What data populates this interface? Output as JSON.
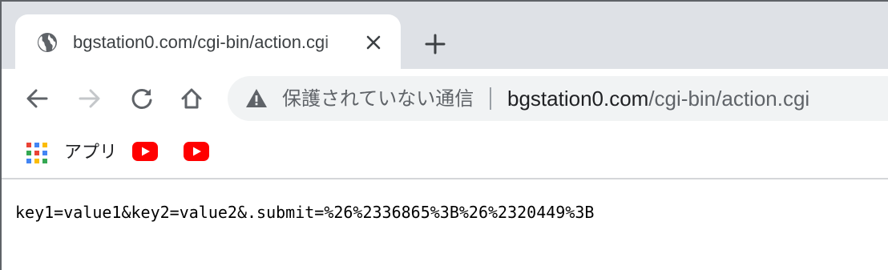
{
  "tab": {
    "title": "bgstation0.com/cgi-bin/action.cgi",
    "favicon_icon": "globe-icon",
    "close_icon": "close-icon"
  },
  "toolbar": {
    "back_icon": "back-arrow-icon",
    "forward_icon": "forward-arrow-icon",
    "reload_icon": "reload-icon",
    "home_icon": "home-icon",
    "new_tab_icon": "plus-icon"
  },
  "omnibox": {
    "security_icon": "warning-triangle-icon",
    "security_text": "保護されていない通信",
    "url_host": "bgstation0.com",
    "url_path": "/cgi-bin/action.cgi"
  },
  "bookmarks": {
    "apps_label": "アプリ",
    "apps_icon": "apps-grid-icon",
    "items": [
      {
        "icon": "youtube-icon"
      },
      {
        "icon": "youtube-icon"
      }
    ]
  },
  "page": {
    "body_text": "key1=value1&key2=value2&.submit=%26%2336865%3B%26%2320449%3B"
  },
  "colors": {
    "tabstrip_bg": "#dee1e6",
    "omnibox_bg": "#f1f3f4",
    "youtube_red": "#ff0000",
    "text_primary": "#202124",
    "text_secondary": "#5f6368"
  }
}
